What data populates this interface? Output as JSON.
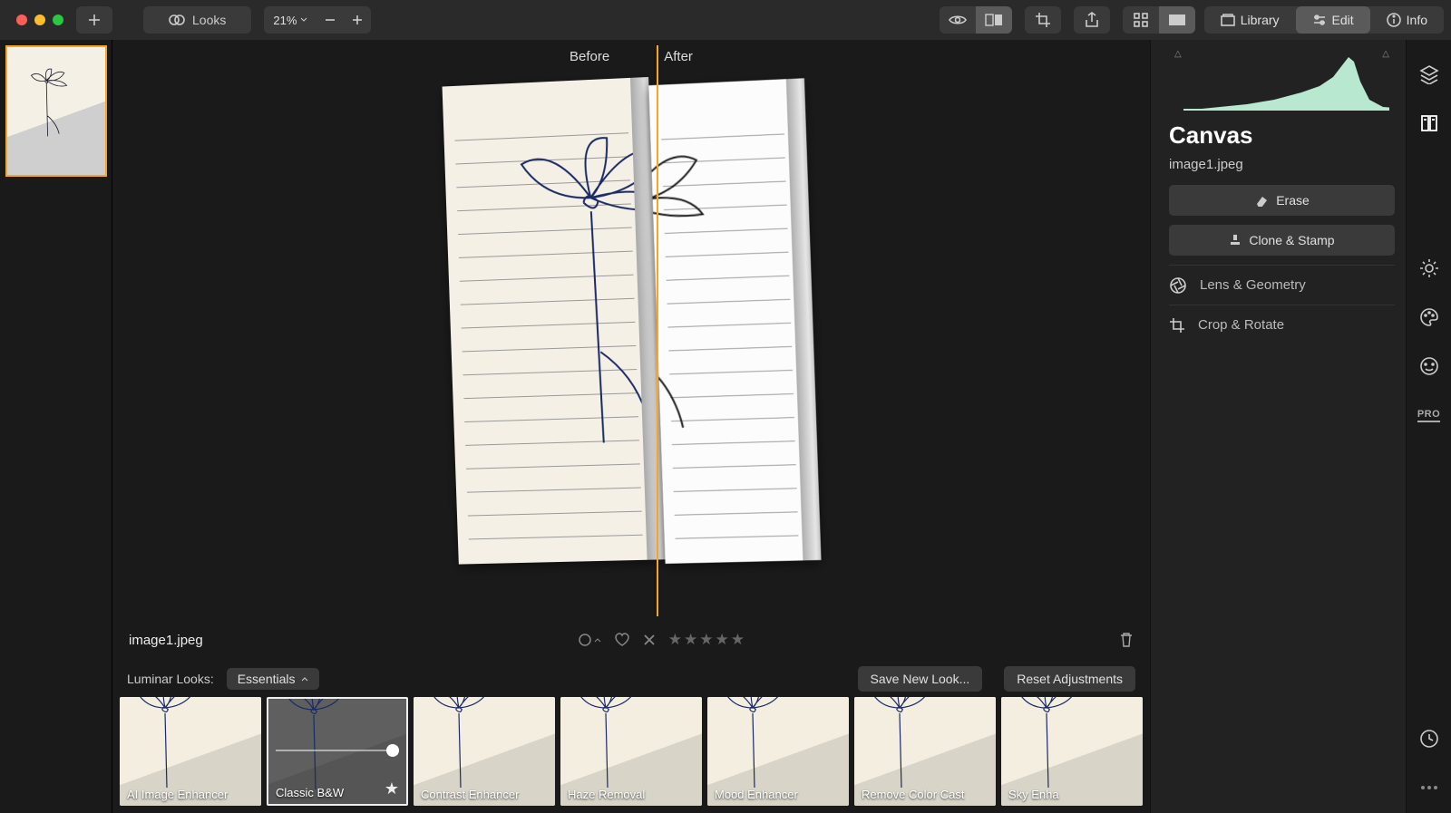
{
  "toolbar": {
    "looks_label": "Looks",
    "zoom_label": "21%",
    "library_label": "Library",
    "edit_label": "Edit",
    "info_label": "Info"
  },
  "compare": {
    "before_label": "Before",
    "after_label": "After"
  },
  "file": {
    "name_main": "image1.jpeg",
    "name_panel": "image1.jpeg"
  },
  "looks_bar": {
    "label": "Luminar Looks:",
    "dropdown": "Essentials",
    "save_label": "Save New Look...",
    "reset_label": "Reset Adjustments"
  },
  "looks": [
    {
      "label": "AI Image Enhancer"
    },
    {
      "label": "Classic B&W",
      "selected": true,
      "bw": true,
      "star": true,
      "slider": true
    },
    {
      "label": "Contrast Enhancer"
    },
    {
      "label": "Haze Removal"
    },
    {
      "label": "Mood Enhancer"
    },
    {
      "label": "Remove Color Cast"
    },
    {
      "label": "Sky Enha"
    }
  ],
  "panel": {
    "title": "Canvas",
    "erase_label": "Erase",
    "clone_label": "Clone & Stamp",
    "lens_label": "Lens & Geometry",
    "crop_label": "Crop & Rotate"
  },
  "rail": {
    "pro_label": "PRO"
  }
}
